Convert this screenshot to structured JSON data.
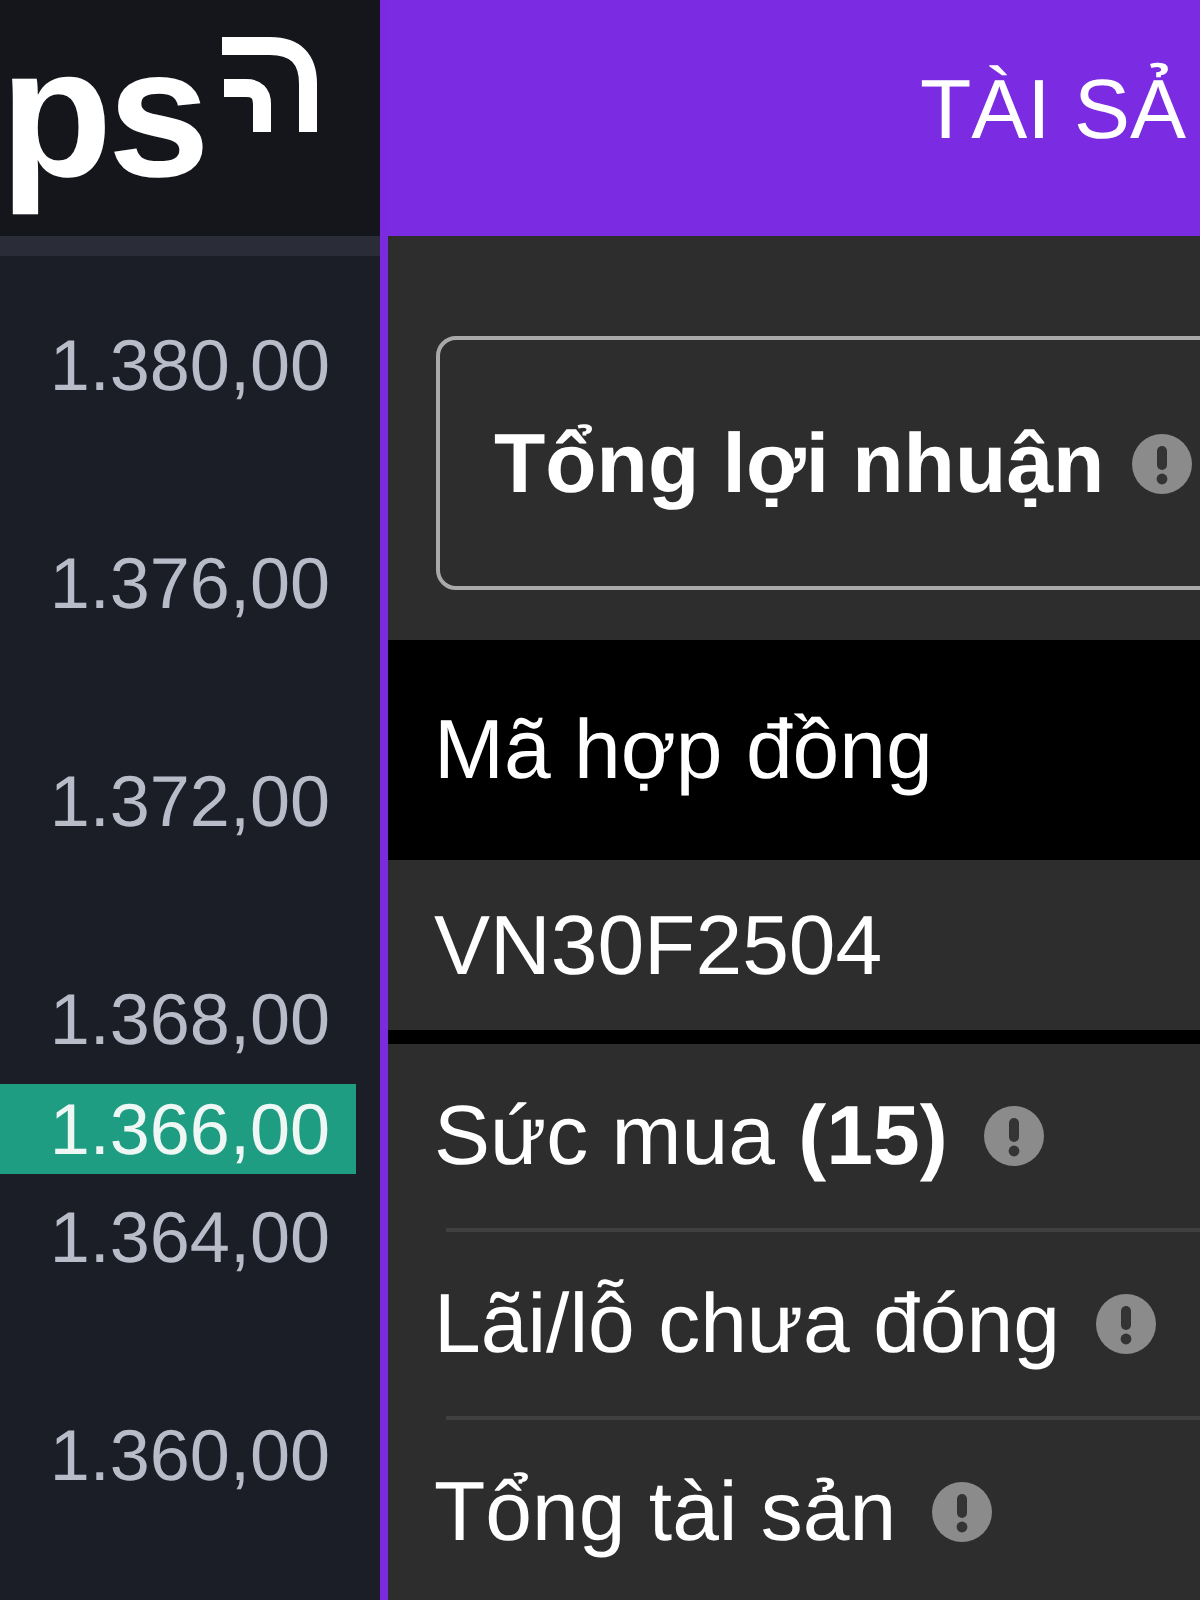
{
  "logo": {
    "text": "ps"
  },
  "header": {
    "title": "TÀI SẢ"
  },
  "price_axis": {
    "labels": [
      "1.380,00",
      "1.376,00",
      "1.372,00",
      "1.368,00",
      "1.364,00",
      "1.360,00"
    ],
    "current_price": "1.366,00"
  },
  "summary_card": {
    "title": "Tổng lợi nhuận"
  },
  "contracts_table": {
    "columns": [
      "Mã hợp đồng"
    ],
    "rows": [
      [
        "VN30F2504"
      ]
    ]
  },
  "account_rows": [
    {
      "label": "Sức mua **(15)**"
    },
    {
      "label": "Lãi/lỗ chưa đóng"
    },
    {
      "label": "Tổng tài sản"
    }
  ]
}
